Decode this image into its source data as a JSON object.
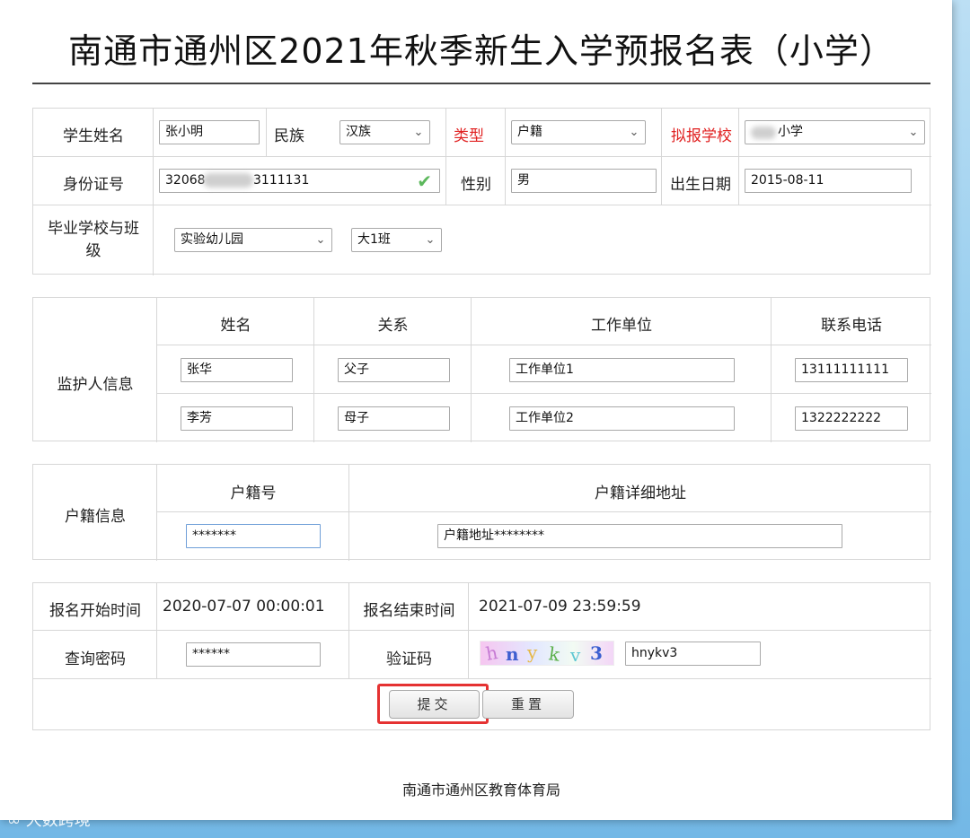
{
  "title": "南通市通州区2021年秋季新生入学预报名表（小学）",
  "student": {
    "name_label": "学生姓名",
    "name_value": "张小明",
    "ethnicity_label": "民族",
    "ethnicity_value": "汉族",
    "type_label": "类型",
    "type_value": "户籍",
    "school_label": "拟报学校",
    "school_value": "小学",
    "id_label": "身份证号",
    "id_prefix": "32068",
    "id_suffix": "3111131",
    "gender_label": "性别",
    "gender_value": "男",
    "birth_label": "出生日期",
    "birth_value": "2015-08-11",
    "grad_label": "毕业学校与班级",
    "grad_school_value": "实验幼儿园",
    "grad_class_value": "大1班"
  },
  "guardian": {
    "section_label": "监护人信息",
    "headers": [
      "姓名",
      "关系",
      "工作单位",
      "联系电话"
    ],
    "rows": [
      [
        "张华",
        "父子",
        "工作单位1",
        "13111111111"
      ],
      [
        "李芳",
        "母子",
        "工作单位2",
        "1322222222"
      ]
    ]
  },
  "hukou": {
    "section_label": "户籍信息",
    "number_header": "户籍号",
    "address_header": "户籍详细地址",
    "number_value": "*******",
    "address_value": "户籍地址********"
  },
  "registration": {
    "start_label": "报名开始时间",
    "start_value": "2020-07-07 00:00:01",
    "end_label": "报名结束时间",
    "end_value": "2021-07-09 23:59:59",
    "password_label": "查询密码",
    "password_value": "******",
    "captcha_label": "验证码",
    "captcha_value": "hnykv3",
    "captcha_chars": [
      "h",
      "n",
      "y",
      "k",
      "v",
      "3"
    ]
  },
  "buttons": {
    "submit": "提交",
    "reset": "重置"
  },
  "footer": "南通市通州区教育体育局",
  "watermark": "大数跨境",
  "colors": {
    "required_label": "#e02020",
    "highlight": "#e53232",
    "check": "#5cb85c"
  }
}
